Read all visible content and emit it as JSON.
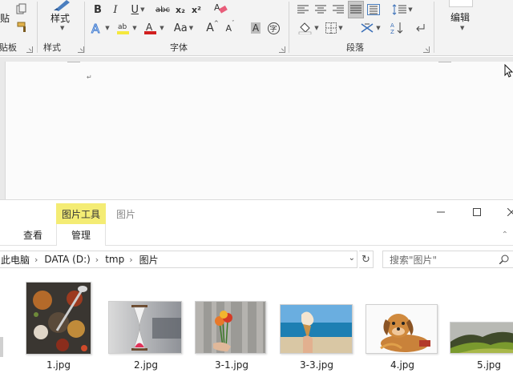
{
  "ribbon": {
    "clipboard": {
      "paste_label": "粘贴",
      "group_label": "剪贴板"
    },
    "styles": {
      "button_label": "样式",
      "group_label": "样式"
    },
    "font": {
      "group_label": "字体",
      "bold": "B",
      "italic": "I",
      "underline": "U",
      "strike": "abc",
      "subscript": "x₂",
      "superscript": "x²",
      "change_case": "Aa",
      "grow": "A",
      "shrink": "A",
      "char_shading": "A",
      "enclose": "字",
      "font_color": "#d11f1f",
      "highlight_color": "#f5e83d"
    },
    "paragraph": {
      "group_label": "段落"
    },
    "editing": {
      "button_label": "编辑"
    }
  },
  "explorer": {
    "context_tab": "图片工具",
    "title": "图片",
    "tabs": {
      "view": "查看",
      "manage": "管理"
    },
    "address": [
      "此电脑",
      "DATA (D:)",
      "tmp",
      "图片"
    ],
    "search_placeholder": "搜索\"图片\"",
    "files": [
      {
        "name": "1.jpg"
      },
      {
        "name": "2.jpg"
      },
      {
        "name": "3-1.jpg"
      },
      {
        "name": "3-3.jpg"
      },
      {
        "name": "4.jpg"
      },
      {
        "name": "5.jpg"
      }
    ]
  }
}
